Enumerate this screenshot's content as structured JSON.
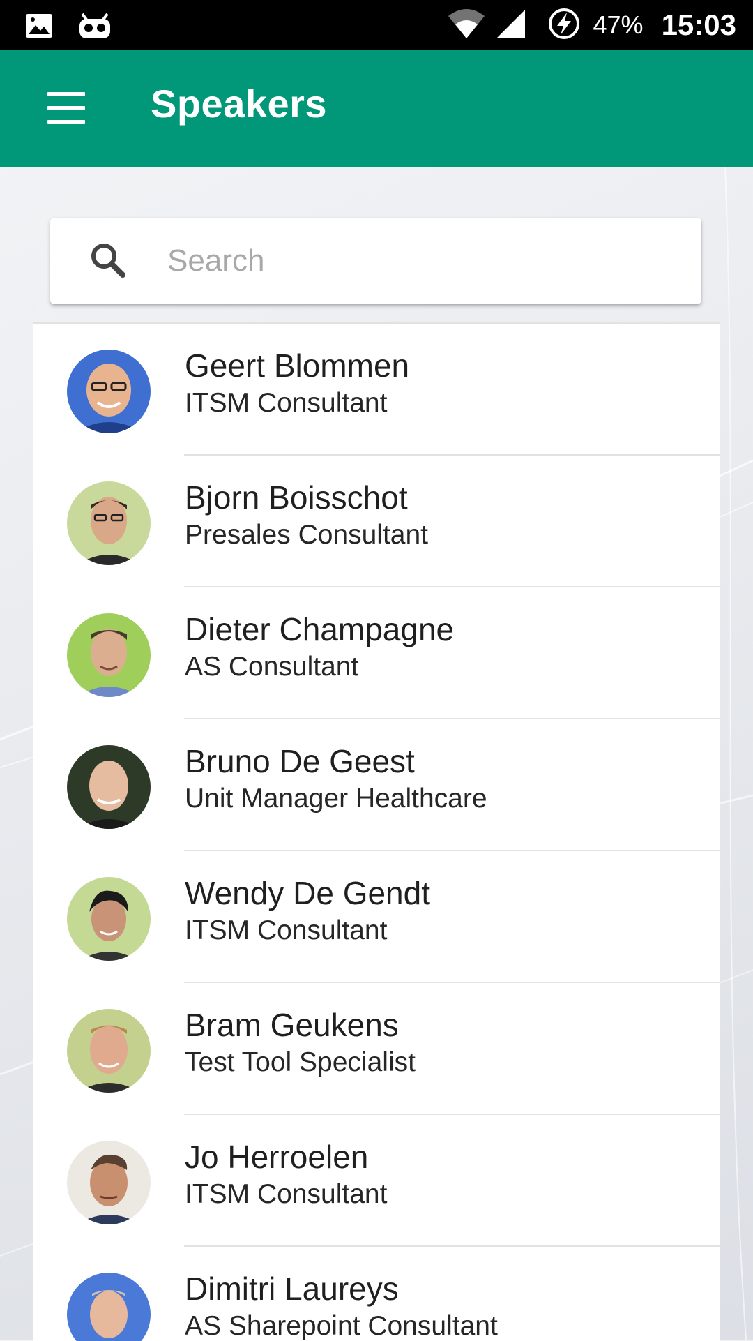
{
  "status_bar": {
    "battery_percent": "47%",
    "time": "15:03",
    "icons": [
      "image-icon",
      "robot-icon",
      "wifi-icon",
      "signal-icon",
      "battery-charging-icon"
    ]
  },
  "app_bar": {
    "title": "Speakers",
    "menu_icon": "hamburger-menu-icon",
    "color": "#009879"
  },
  "search": {
    "placeholder": "Search",
    "value": "",
    "icon": "search-icon"
  },
  "speakers": [
    {
      "name": "Geert Blommen",
      "role": "ITSM Consultant",
      "avatar_bg": "#3f6fd1"
    },
    {
      "name": "Bjorn Boisschot",
      "role": "Presales Consultant",
      "avatar_bg": "#c9d99b"
    },
    {
      "name": "Dieter Champagne",
      "role": "AS Consultant",
      "avatar_bg": "#9fcf5a"
    },
    {
      "name": "Bruno De Geest",
      "role": "Unit Manager Healthcare",
      "avatar_bg": "#2e3a28"
    },
    {
      "name": "Wendy De Gendt",
      "role": "ITSM Consultant",
      "avatar_bg": "#c4d993"
    },
    {
      "name": "Bram Geukens",
      "role": "Test Tool Specialist",
      "avatar_bg": "#c3d08e"
    },
    {
      "name": "Jo Herroelen",
      "role": "ITSM Consultant",
      "avatar_bg": "#ece9e3"
    },
    {
      "name": "Dimitri Laureys",
      "role": "AS Sharepoint Consultant",
      "avatar_bg": "#4a79d8"
    }
  ]
}
